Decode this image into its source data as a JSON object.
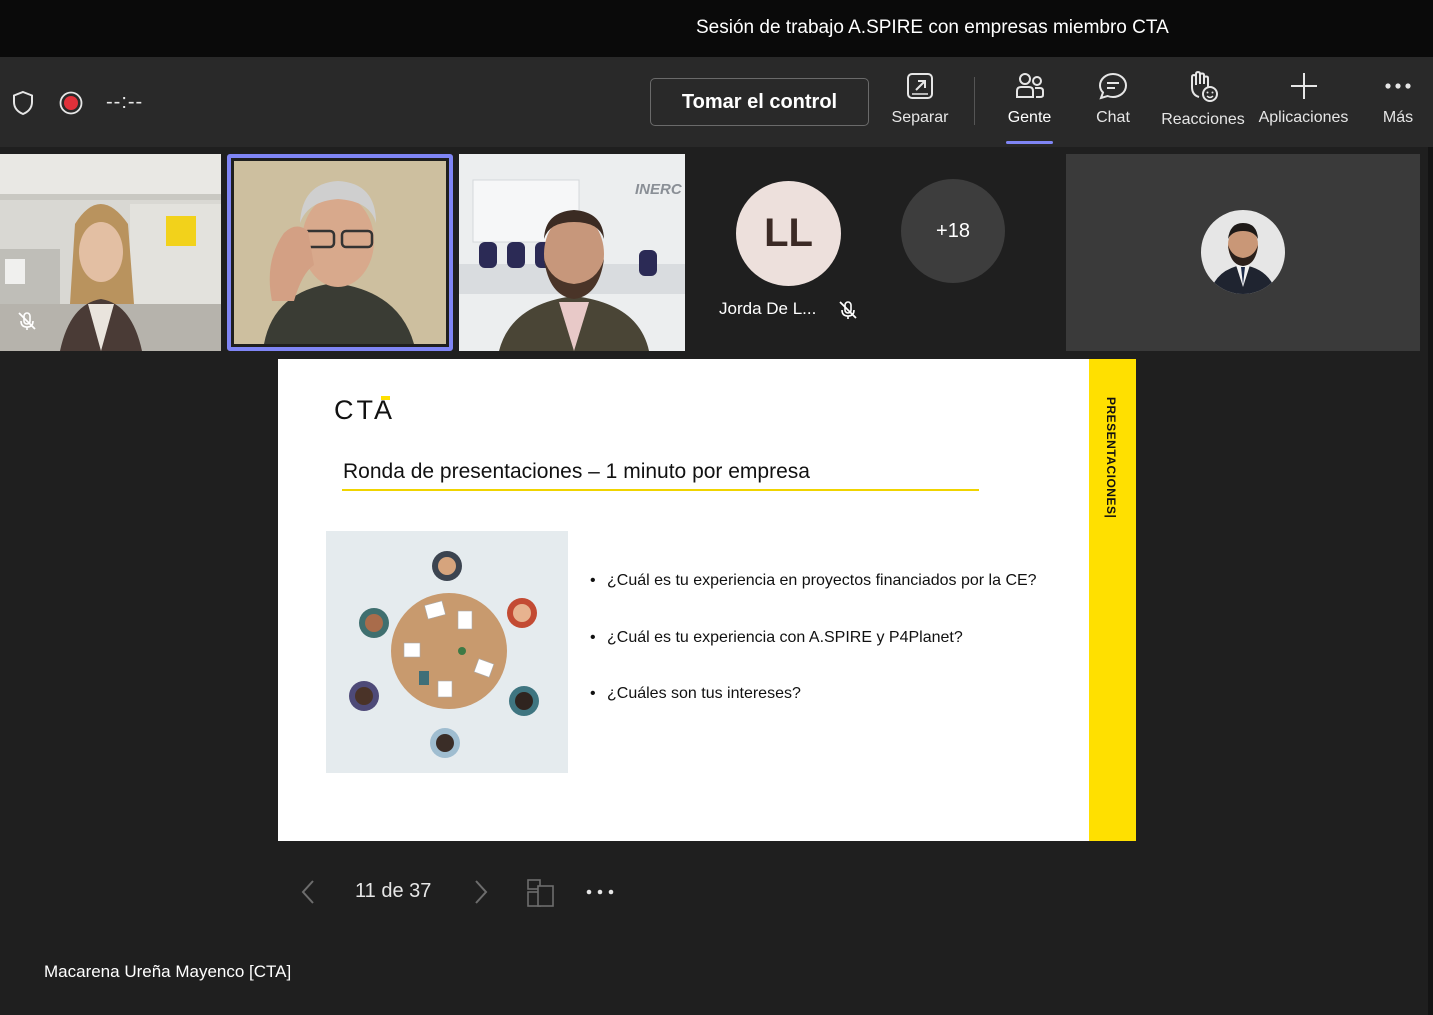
{
  "window": {
    "title": "Sesión de trabajo A.SPIRE con empresas miembro CTA"
  },
  "toolbar": {
    "timer": "--:--",
    "take_control": "Tomar el control",
    "tools": [
      {
        "label": "Separar",
        "icon": "pop-out-icon"
      },
      {
        "label": "Gente",
        "icon": "people-icon",
        "active": true
      },
      {
        "label": "Chat",
        "icon": "chat-icon"
      },
      {
        "label": "Reacciones",
        "icon": "raise-hand-icon"
      },
      {
        "label": "Aplicaciones",
        "icon": "plus-icon"
      },
      {
        "label": "Más",
        "icon": "more-icon"
      }
    ]
  },
  "participants": {
    "ll": {
      "initials": "LL",
      "name": "Jorda De L...",
      "muted": true
    },
    "overflow": {
      "label": "+18"
    }
  },
  "slide": {
    "logo": "CTA",
    "side_label": "PRESENTACIONES|",
    "heading": "Ronda de presentaciones – 1 minuto por empresa",
    "bullets": [
      "¿Cuál es tu experiencia en proyectos financiados por la CE?",
      "¿Cuál es tu experiencia con A.SPIRE y P4Planet?",
      "¿Cuáles son tus intereses?"
    ]
  },
  "slide_nav": {
    "page": "11 de 37"
  },
  "presenter": {
    "name": "Macarena Ureña Mayenco [CTA]"
  },
  "colors": {
    "accent": "#7f85f5",
    "slide_yellow": "#ffe000",
    "record": "#e0303a"
  }
}
